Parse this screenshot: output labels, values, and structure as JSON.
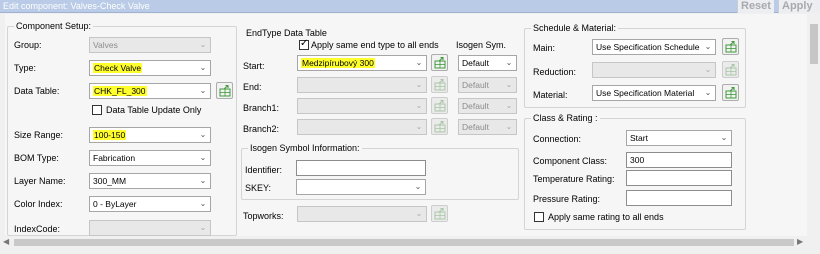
{
  "window": {
    "title": "Edit component: Valves-Check Valve",
    "reset_label": "Reset",
    "apply_label": "Apply"
  },
  "component_setup": {
    "legend": "Component Setup:",
    "group": {
      "label": "Group:",
      "value": "Valves"
    },
    "type": {
      "label": "Type:",
      "value": "Check Valve"
    },
    "data_table": {
      "label": "Data Table:",
      "value": "CHK_FL_300"
    },
    "data_table_update_only": {
      "label": "Data Table Update Only",
      "checked": false
    },
    "size_range": {
      "label": "Size Range:",
      "value": "100-150"
    },
    "bom_type": {
      "label": "BOM Type:",
      "value": "Fabrication"
    },
    "layer_name": {
      "label": "Layer Name:",
      "value": "300_MM"
    },
    "color_index": {
      "label": "Color Index:",
      "value": "0 - ByLayer"
    },
    "index_code": {
      "label": "IndexCode:",
      "value": ""
    }
  },
  "endtype": {
    "legend": "EndType Data Table",
    "apply_same": {
      "label": "Apply same end type to all ends",
      "checked": true
    },
    "isogen_sym_header": "Isogen Sym.",
    "start": {
      "label": "Start:",
      "value": "Medzipírubový 300",
      "isogen": "Default"
    },
    "end": {
      "label": "End:",
      "value": "",
      "isogen": "Default"
    },
    "branch1": {
      "label": "Branch1:",
      "value": "",
      "isogen": "Default"
    },
    "branch2": {
      "label": "Branch2:",
      "value": "",
      "isogen": "Default"
    },
    "isogen_info": {
      "legend": "Isogen Symbol Information:",
      "identifier_label": "Identifier:",
      "identifier_value": "",
      "skey_label": "SKEY:",
      "skey_value": ""
    },
    "topworks": {
      "label": "Topworks:",
      "value": ""
    }
  },
  "schedule_material": {
    "legend": "Schedule & Material:",
    "main": {
      "label": "Main:",
      "value": "Use Specification Schedule"
    },
    "reduction": {
      "label": "Reduction:",
      "value": ""
    },
    "material": {
      "label": "Material:",
      "value": "Use Specification Material"
    }
  },
  "class_rating": {
    "legend": "Class & Rating :",
    "connection": {
      "label": "Connection:",
      "value": "Start"
    },
    "component_class": {
      "label": "Component Class:",
      "value": "300"
    },
    "temperature_rating": {
      "label": "Temperature Rating:",
      "value": ""
    },
    "pressure_rating": {
      "label": "Pressure Rating:",
      "value": ""
    },
    "apply_same_rating": {
      "label": "Apply same rating to all ends",
      "checked": false
    }
  },
  "icons": {
    "table_button": "table-arrow-icon",
    "dropdown": "chevron-down-icon"
  },
  "colors": {
    "highlight": "#ffff2e",
    "titlebar": "#b9cbe6",
    "table_icon_green": "#3f9a3c"
  }
}
